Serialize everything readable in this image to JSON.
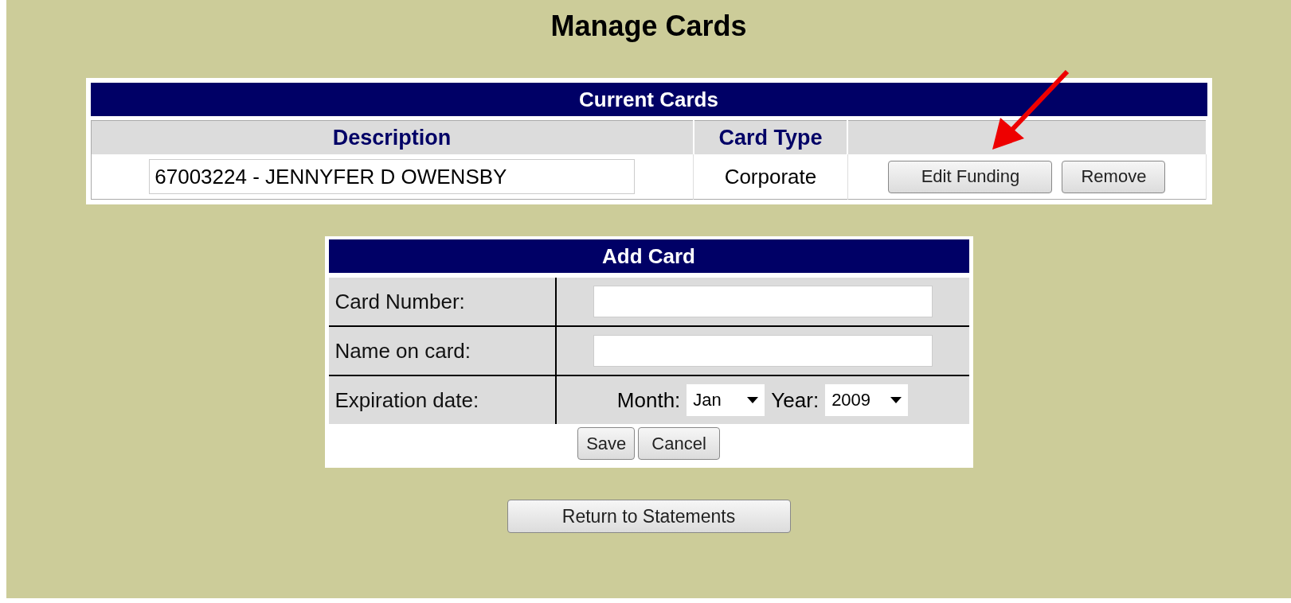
{
  "page_title": "Manage Cards",
  "current_cards": {
    "title": "Current Cards",
    "columns": [
      "Description",
      "Card Type"
    ],
    "rows": [
      {
        "description": "67003224 - JENNYFER D OWENSBY",
        "card_type": "Corporate",
        "actions": [
          "Edit Funding",
          "Remove"
        ]
      }
    ]
  },
  "add_card": {
    "title": "Add Card",
    "fields": [
      {
        "kind": "text",
        "label": "Card Number:"
      },
      {
        "kind": "text",
        "label": "Name on card:"
      },
      {
        "kind": "date",
        "label": "Expiration date:",
        "month_label": "Month:",
        "month": "Jan",
        "year_label": "Year:",
        "year": "2009"
      }
    ],
    "buttons": [
      "Save",
      "Cancel"
    ]
  },
  "return_button": "Return to Statements"
}
